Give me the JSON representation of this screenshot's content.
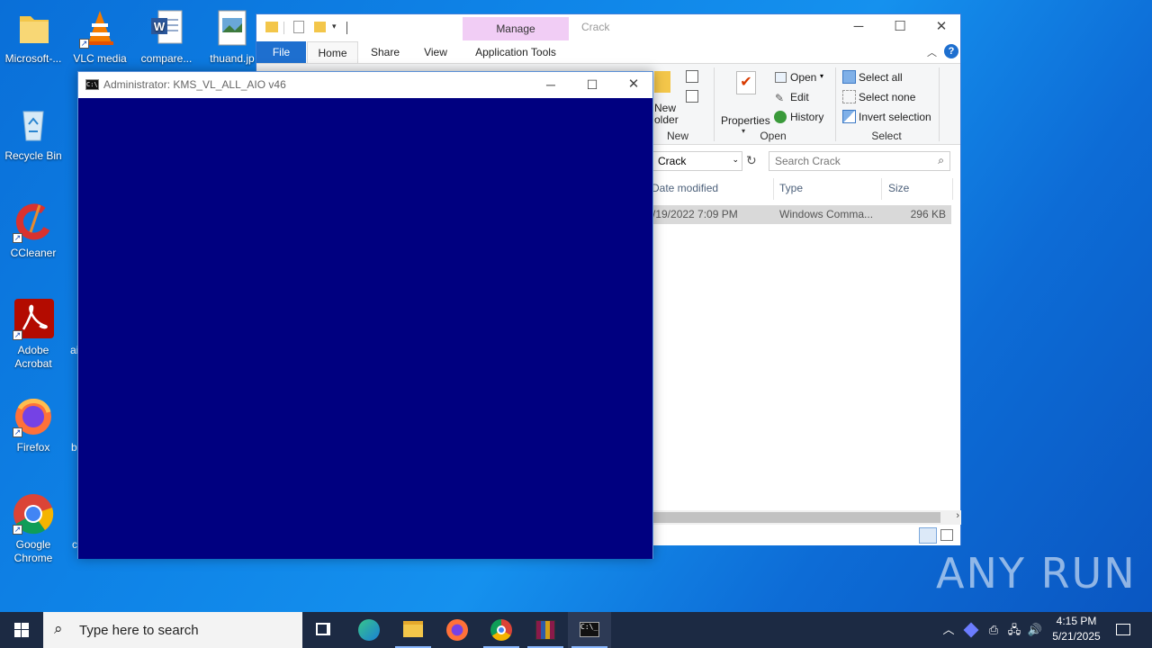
{
  "desktop": {
    "icons": [
      {
        "label": "Microsoft-...",
        "icon": "folder-icon"
      },
      {
        "label": "VLC media",
        "icon": "vlc-icon"
      },
      {
        "label": "compare...",
        "icon": "word-document-icon"
      },
      {
        "label": "thuand.jp",
        "icon": "image-file-icon"
      },
      {
        "label": "Recycle Bin",
        "icon": "recycle-bin-icon"
      },
      {
        "label": "CCleaner",
        "icon": "ccleaner-icon"
      },
      {
        "label": "Adobe Acrobat",
        "icon": "acrobat-icon"
      },
      {
        "label": "Firefox",
        "icon": "firefox-icon"
      },
      {
        "label": "Google Chrome",
        "icon": "chrome-icon"
      }
    ],
    "partial_labels": [
      "ai",
      "b",
      "c"
    ]
  },
  "explorer": {
    "title": "Crack",
    "context_tab": "Manage",
    "tabs": [
      "File",
      "Home",
      "Share",
      "View",
      "Application Tools"
    ],
    "ribbon": {
      "new_label": "New",
      "new_folder_label_1": "New",
      "new_folder_label_2": "older",
      "properties_label": "Properties",
      "open_label": "Open",
      "edit_label": "Edit",
      "history_label": "History",
      "open_group": "Open",
      "select_all": "Select all",
      "select_none": "Select none",
      "invert_selection": "Invert selection",
      "select_group": "Select"
    },
    "address": "Crack",
    "search_placeholder": "Search Crack",
    "columns": [
      "Date modified",
      "Type",
      "Size"
    ],
    "rows": [
      {
        "date": "/19/2022 7:09 PM",
        "type": "Windows Comma...",
        "size": "296 KB"
      }
    ]
  },
  "cmd": {
    "title": "Administrator:  KMS_VL_ALL_AIO v46",
    "bg_color": "#000080"
  },
  "taskbar": {
    "search_placeholder": "Type here to search",
    "time": "4:15 PM",
    "date": "5/21/2025"
  },
  "watermark": "ANY RUN"
}
